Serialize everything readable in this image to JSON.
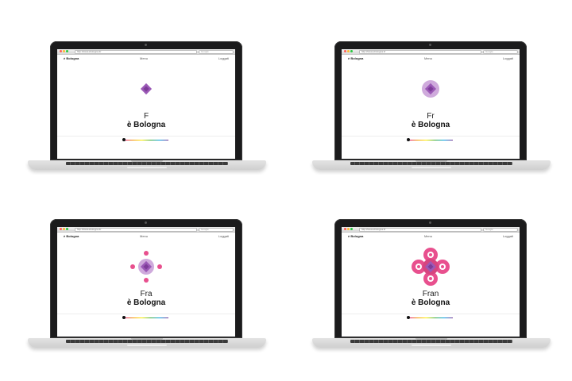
{
  "browser": {
    "url": "http://www.ebologna.it/",
    "search_placeholder": "Google"
  },
  "site": {
    "brand": "è Bologna",
    "menu_label": "Menu",
    "login_label": "Loggati",
    "headline": "è Bologna"
  },
  "frames": [
    {
      "typed_text": "F",
      "stage": 1
    },
    {
      "typed_text": "Fr",
      "stage": 2
    },
    {
      "typed_text": "Fra",
      "stage": 3
    },
    {
      "typed_text": "Fran",
      "stage": 4
    }
  ],
  "colors": {
    "diamond": "#9b59b6",
    "halo": "#c79bd6",
    "accent": "#e8508e",
    "slider_knob": "#111111"
  }
}
